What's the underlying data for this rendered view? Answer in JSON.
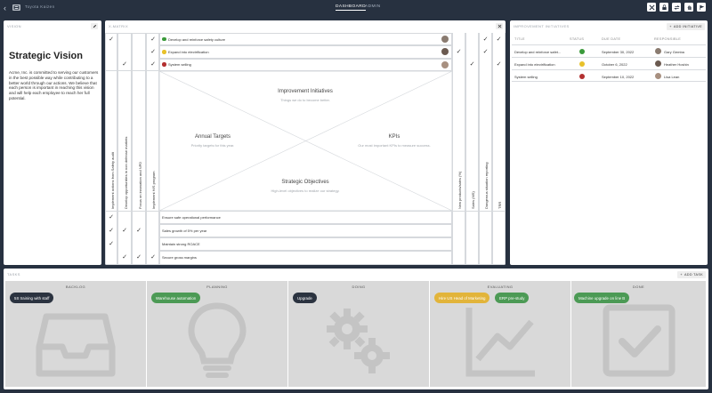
{
  "header": {
    "app_name": "Toyota Kaizen",
    "tabs": [
      {
        "label": "DASHBOARD",
        "active": true
      },
      {
        "label": "ADMIN",
        "active": false
      }
    ],
    "buttons": [
      "expand-icon",
      "lock-icon",
      "refresh-icon",
      "hand-icon",
      "flag-icon"
    ]
  },
  "vision": {
    "title": "VISION",
    "heading": "Strategic Vision",
    "text": "Acme, Inc. is committed to serving our customers in the best possible way while contributing to a better world through our actions. We believe that each person is important in reaching this vision and will help each employee to reach her full potential."
  },
  "xmatrix": {
    "title": "X-MATRIX",
    "initiatives": [
      {
        "label": "Develop and reinforce safety culture",
        "color": "#3a9a3a"
      },
      {
        "label": "Expand into electrification",
        "color": "#e8c12a"
      },
      {
        "label": "System selling",
        "color": "#b33030"
      }
    ],
    "left_columns": [
      "Implement actions from Safety audit",
      "Develop opportunities in non defense markets",
      "Focus on innovation and NPD",
      "Implement H/S program"
    ],
    "right_columns": [
      "New products/sales (%)",
      "Sales (MS)",
      "Dangerous situation reporting",
      "TRR"
    ],
    "annual_targets": [
      "Ensure safe operational performance",
      "Sales growth of 5% per year",
      "Maintain strong ROACE",
      "Secure gross margins"
    ],
    "quadrants": {
      "top_title": "Improvement Initiatives",
      "top_sub": "Things we do to become better.",
      "left_title": "Annual Targets",
      "left_sub": "Priority targets for this year.",
      "right_title": "KPIs",
      "right_sub": "Our most important KPIs to measure success.",
      "bottom_title": "Strategic Objectives",
      "bottom_sub": "High-level objectives to realize our strategy."
    }
  },
  "improvement": {
    "title": "IMPROVEMENT INITIATIVES",
    "add_label": "ADD INITIATIVE",
    "headers": [
      "TITLE",
      "STATUS",
      "DUE DATE",
      "RESPONSIBLE"
    ],
    "rows": [
      {
        "title": "Develop and reinforce safet...",
        "status_color": "#3a9a3a",
        "due": "September 30, 2022",
        "responsible": "Gary Gemba"
      },
      {
        "title": "Expand into electrification",
        "status_color": "#e8c12a",
        "due": "October 6, 2022",
        "responsible": "Heather Hoshin"
      },
      {
        "title": "System selling",
        "status_color": "#b33030",
        "due": "September 10, 2022",
        "responsible": "Lisa Lean"
      }
    ]
  },
  "tasks": {
    "title": "TASKS",
    "add_label": "ADD TASK",
    "columns": [
      {
        "name": "BACKLOG",
        "icon": "inbox-icon",
        "cards": [
          {
            "label": "5S training with staff",
            "color": "#2b3340"
          }
        ]
      },
      {
        "name": "PLANNING",
        "icon": "lightbulb-icon",
        "cards": [
          {
            "label": "Warehouse automation",
            "color": "#4c9a55"
          }
        ]
      },
      {
        "name": "DOING",
        "icon": "gears-icon",
        "cards": [
          {
            "label": "Upgrade",
            "color": "#2b3340"
          }
        ]
      },
      {
        "name": "EVALUATING",
        "icon": "chart-icon",
        "cards": [
          {
            "label": "Hire US Head of Marketing",
            "color": "#e2b43a"
          },
          {
            "label": "ERP pre-study",
            "color": "#4c9a55"
          }
        ]
      },
      {
        "name": "DONE",
        "icon": "checkbox-icon",
        "cards": [
          {
            "label": "Machine upgrade on line B",
            "color": "#4c9a55"
          }
        ]
      }
    ]
  }
}
